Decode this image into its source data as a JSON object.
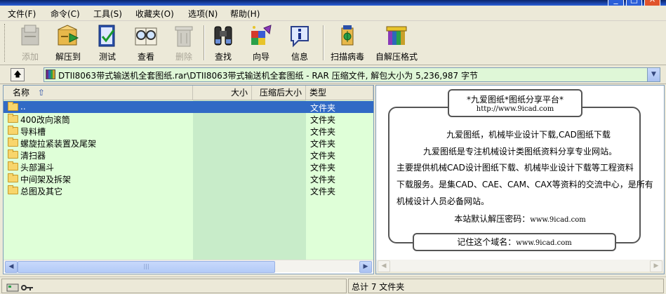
{
  "menu": [
    "文件(F)",
    "命令(C)",
    "工具(S)",
    "收藏夹(O)",
    "选项(N)",
    "帮助(H)"
  ],
  "toolbar": [
    {
      "label": "添加",
      "icon": "add-icon",
      "disabled": true
    },
    {
      "label": "解压到",
      "icon": "extract-icon",
      "disabled": false
    },
    {
      "label": "测试",
      "icon": "test-icon",
      "disabled": false
    },
    {
      "label": "查看",
      "icon": "view-icon",
      "disabled": false
    },
    {
      "label": "删除",
      "icon": "delete-icon",
      "disabled": true
    },
    {
      "label": "查找",
      "icon": "find-icon",
      "disabled": false
    },
    {
      "label": "向导",
      "icon": "wizard-icon",
      "disabled": false
    },
    {
      "label": "信息",
      "icon": "info-icon",
      "disabled": false
    },
    {
      "label": "扫描病毒",
      "icon": "virus-scan-icon",
      "disabled": false
    },
    {
      "label": "自解压格式",
      "icon": "sfx-icon",
      "disabled": false
    }
  ],
  "address": {
    "path": "DTII8063带式输送机全套图纸.rar\\DTII8063带式输送机全套图纸 - RAR 压缩文件, 解包大小为 5,236,987 字节"
  },
  "columns": {
    "name": "名称",
    "size": "大小",
    "packed": "压缩后大小",
    "type": "类型"
  },
  "files": [
    {
      "name": "..",
      "type": "文件夹",
      "selected": true
    },
    {
      "name": "400改向滚筒",
      "type": "文件夹",
      "selected": false
    },
    {
      "name": "导料槽",
      "type": "文件夹",
      "selected": false
    },
    {
      "name": "螺旋拉紧装置及尾架",
      "type": "文件夹",
      "selected": false
    },
    {
      "name": "清扫器",
      "type": "文件夹",
      "selected": false
    },
    {
      "name": "头部漏斗",
      "type": "文件夹",
      "selected": false
    },
    {
      "name": "中间架及拆架",
      "type": "文件夹",
      "selected": false
    },
    {
      "name": "总图及其它",
      "type": "文件夹",
      "selected": false
    }
  ],
  "info": {
    "banner_title": "*九爱图纸*图纸分享平台*",
    "banner_url": "http://www.9icad.com",
    "line1": "九爱图纸，机械毕业设计下载,CAD图纸下载",
    "line2": "九爱图纸是专注机械设计类图纸资料分享专业网站。",
    "line3": "主要提供机械CAD设计图纸下载、机械毕业设计下载等工程资料",
    "line4": "下载服务。是集CAD、CAE、CAM、CAX等资料的交流中心，是所有",
    "line5": "机械设计人员必备网站。",
    "password_label": "本站默认解压密码：",
    "password_value": "www.9icad.com",
    "remember_label": "记住这个域名：",
    "remember_value": "www.9icad.com"
  },
  "status": {
    "total": "总计 7 文件夹"
  },
  "colors": {
    "selected_row": "#316ac5",
    "name_column_bg": "#dfffd8",
    "size_column_bg": "#c8ecc9"
  }
}
